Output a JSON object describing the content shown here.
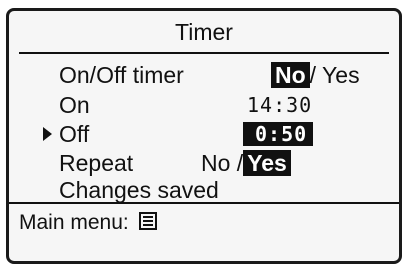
{
  "screen": {
    "title": "Timer",
    "rows": {
      "onoff": {
        "label": "On/Off timer",
        "option_no": "No",
        "separator": "/",
        "option_yes": "Yes"
      },
      "on": {
        "label": "On",
        "value": "14:30"
      },
      "off": {
        "label": "Off",
        "value": "0:50"
      },
      "repeat": {
        "label": "Repeat",
        "option_no": "No",
        "separator": "/",
        "option_yes": "Yes"
      },
      "status": "Changes saved"
    },
    "footer": {
      "label": "Main menu:",
      "icon": "menu-list-icon"
    }
  }
}
